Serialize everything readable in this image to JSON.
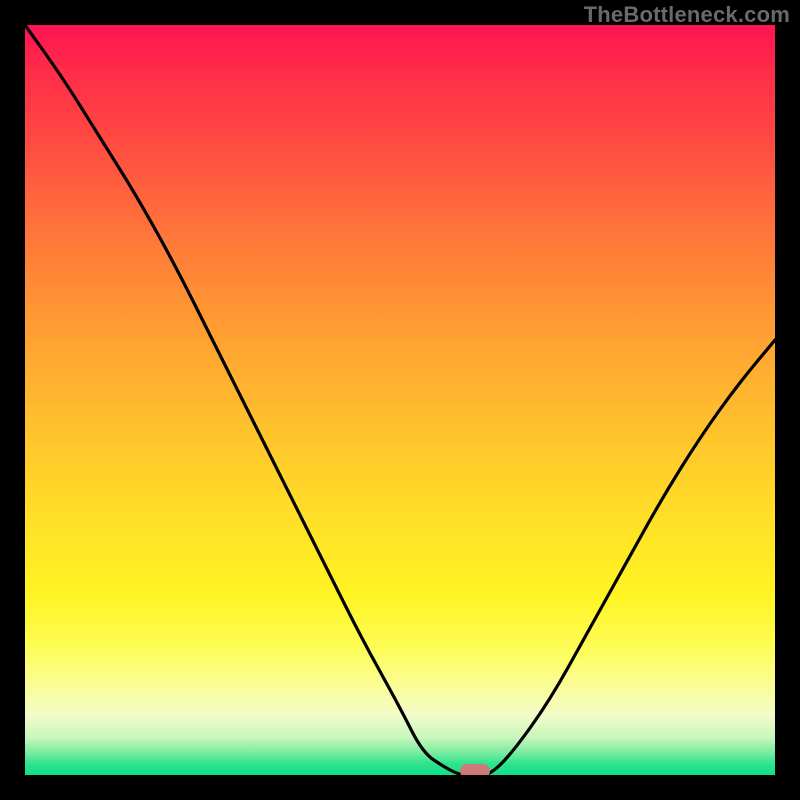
{
  "watermark": "TheBottleneck.com",
  "chart_data": {
    "type": "line",
    "title": "",
    "xlabel": "",
    "ylabel": "",
    "xlim": [
      0,
      100
    ],
    "ylim": [
      0,
      100
    ],
    "x": [
      0,
      5,
      10,
      15,
      20,
      25,
      30,
      35,
      40,
      45,
      50,
      53,
      56,
      58,
      60,
      62,
      65,
      70,
      75,
      80,
      85,
      90,
      95,
      100
    ],
    "values": [
      100,
      93,
      85,
      77,
      68,
      58,
      48,
      38,
      28,
      18,
      9,
      3,
      1,
      0,
      0,
      0,
      3,
      10,
      19,
      28,
      37,
      45,
      52,
      58
    ],
    "marker": {
      "x": 60,
      "y": 0
    },
    "gradient_stops": [
      {
        "pct": 0,
        "color": "#ff1452"
      },
      {
        "pct": 50,
        "color": "#ffbd2e"
      },
      {
        "pct": 85,
        "color": "#fdfd70"
      },
      {
        "pct": 100,
        "color": "#0fe089"
      }
    ]
  }
}
